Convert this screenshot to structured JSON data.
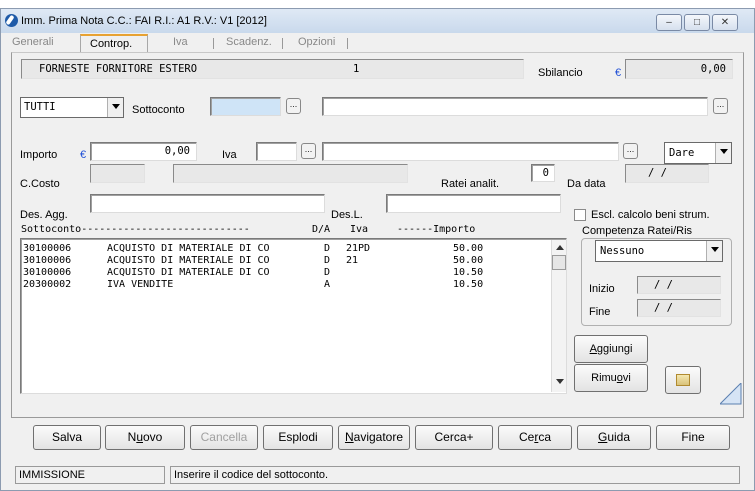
{
  "window": {
    "title": "Imm. Prima Nota C.C.: FAI  R.I.: A1  R.V.: V1  [2012]"
  },
  "tabs": [
    {
      "label": "Generali"
    },
    {
      "label": "Controp."
    },
    {
      "label": "Iva"
    },
    {
      "label": "Scadenz."
    },
    {
      "label": "Opzioni"
    }
  ],
  "header": {
    "account_name": "FORNESTE FORNITORE ESTERO",
    "account_value": "1",
    "sbilancio_label": "Sbilancio",
    "currency_symbol": "€",
    "sbilancio_value": "0,00"
  },
  "form": {
    "filter_selected": "TUTTI",
    "sottoconto_label": "Sottoconto",
    "sottoconto_value": "",
    "sottoconto_desc": "",
    "importo_label": "Importo",
    "importo_value": "0,00",
    "iva_label": "Iva",
    "iva_value": "",
    "iva_desc": "",
    "dare_selected": "Dare",
    "ccosto_label": "C.Costo",
    "ratei_label": "Ratei analit.",
    "ratei_value": "0",
    "da_data_label": "Da data",
    "da_data_value": "/  /",
    "des_agg_label": "Des. Agg.",
    "des_l_label": "Des.L.",
    "escl_label": "Escl. calcolo beni strum.",
    "escl_checked": false
  },
  "list": {
    "header": {
      "sottoconto": "Sottoconto----------------------------",
      "da": "D/A",
      "iva": "Iva",
      "importo": "------Importo"
    },
    "rows": [
      {
        "code": "30100006",
        "desc": "ACQUISTO DI MATERIALE DI CO",
        "da": "D",
        "iva": "21PD",
        "importo": "50.00"
      },
      {
        "code": "30100006",
        "desc": "ACQUISTO DI MATERIALE DI CO",
        "da": "D",
        "iva": "21",
        "importo": "50.00"
      },
      {
        "code": "30100006",
        "desc": "ACQUISTO DI MATERIALE DI CO",
        "da": "D",
        "iva": "",
        "importo": "10.50"
      },
      {
        "code": "20300002",
        "desc": "IVA VENDITE",
        "da": "A",
        "iva": "",
        "importo": "10.50"
      }
    ]
  },
  "competenza": {
    "label": "Competenza Ratei/Ris",
    "selected": "Nessuno",
    "inizio_label": "Inizio",
    "inizio_value": "/  /",
    "fine_label": "Fine",
    "fine_value": "/  /"
  },
  "side_buttons": {
    "aggiungi": {
      "pre": "",
      "key": "A",
      "post": "ggiungi"
    },
    "rimuovi": {
      "pre": "Rimu",
      "key": "o",
      "post": "vi"
    }
  },
  "buttons": [
    {
      "id": "salva",
      "pre": "Salva",
      "key": "",
      "post": "",
      "disabled": false
    },
    {
      "id": "nuovo",
      "pre": "N",
      "key": "u",
      "post": "ovo",
      "disabled": false
    },
    {
      "id": "cancella",
      "pre": "Cancella",
      "key": "",
      "post": "",
      "disabled": true
    },
    {
      "id": "esplodi",
      "pre": "Esplodi",
      "key": "",
      "post": "",
      "disabled": false
    },
    {
      "id": "navigatore",
      "pre": "",
      "key": "N",
      "post": "avigatore",
      "disabled": false
    },
    {
      "id": "cerca-plus",
      "pre": "Cerca+",
      "key": "",
      "post": "",
      "disabled": false
    },
    {
      "id": "cerca",
      "pre": "Ce",
      "key": "r",
      "post": "ca",
      "disabled": false
    },
    {
      "id": "guida",
      "pre": "",
      "key": "G",
      "post": "uida",
      "disabled": false
    },
    {
      "id": "fine",
      "pre": "Fine",
      "key": "",
      "post": "",
      "disabled": false
    }
  ],
  "status": {
    "mode": "IMMISSIONE",
    "message": "Inserire il codice del sottoconto."
  },
  "colors": {
    "tab_accent": "#e8a232",
    "focused_field": "#cfe4f7",
    "euro": "#1f4fd6"
  }
}
